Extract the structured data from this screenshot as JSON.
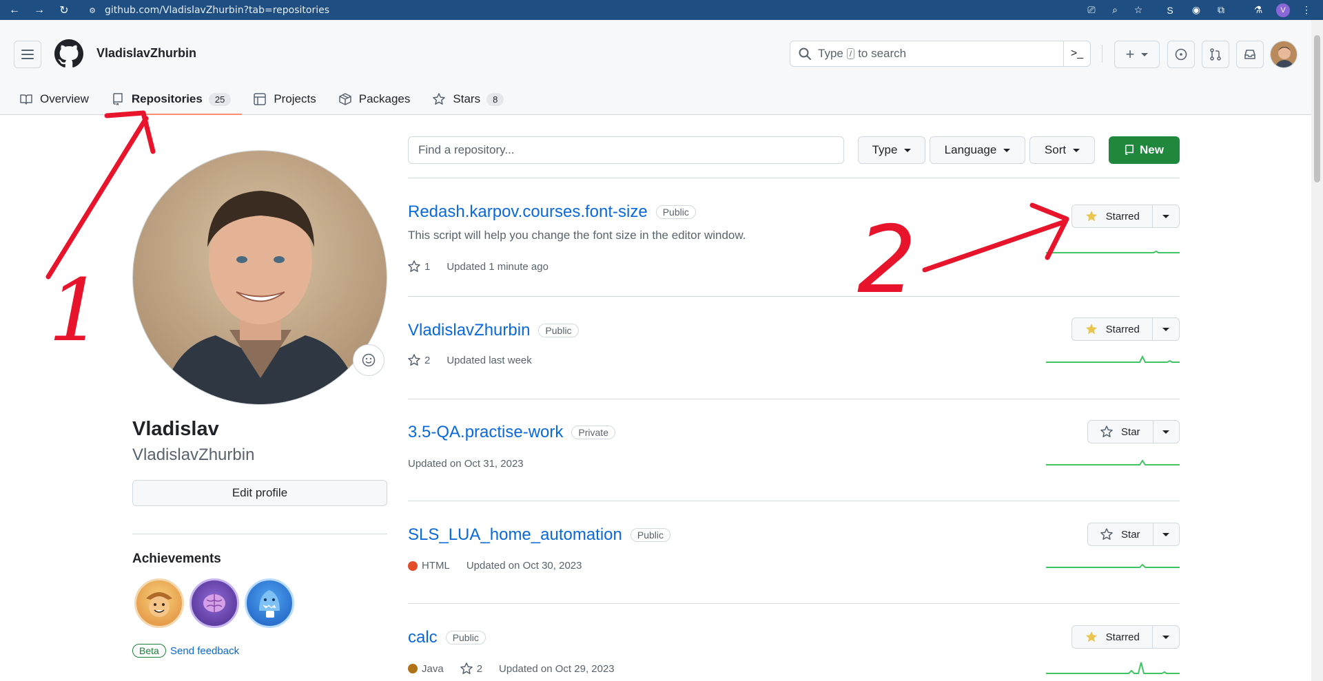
{
  "browser": {
    "url": "github.com/VladislavZhurbin?tab=repositories",
    "profile_initial": "V"
  },
  "header": {
    "username": "VladislavZhurbin",
    "search_placeholder_before": "Type",
    "search_key": "/",
    "search_placeholder_after": "to search"
  },
  "tabs": [
    {
      "label": "Overview",
      "icon": "book-icon"
    },
    {
      "label": "Repositories",
      "icon": "repo-icon",
      "count": "25",
      "active": true
    },
    {
      "label": "Projects",
      "icon": "table-icon"
    },
    {
      "label": "Packages",
      "icon": "package-icon"
    },
    {
      "label": "Stars",
      "icon": "star-icon",
      "count": "8"
    }
  ],
  "profile": {
    "name": "Vladislav",
    "login": "VladislavZhurbin",
    "edit_label": "Edit profile",
    "achievements_title": "Achievements",
    "beta_label": "Beta",
    "feedback_label": "Send feedback"
  },
  "filters": {
    "search_placeholder": "Find a repository...",
    "type_label": "Type",
    "language_label": "Language",
    "sort_label": "Sort",
    "new_label": "New"
  },
  "repos": [
    {
      "name": "Redash.karpov.courses.font-size",
      "visibility": "Public",
      "description": "This script will help you change the font size in the editor window.",
      "stars": "1",
      "updated": "Updated 1 minute ago",
      "star_label": "Starred",
      "starred": true
    },
    {
      "name": "VladislavZhurbin",
      "visibility": "Public",
      "stars": "2",
      "updated": "Updated last week",
      "star_label": "Starred",
      "starred": true
    },
    {
      "name": "3.5-QA.practise-work",
      "visibility": "Private",
      "updated": "Updated on Oct 31, 2023",
      "star_label": "Star",
      "starred": false
    },
    {
      "name": "SLS_LUA_home_automation",
      "visibility": "Public",
      "language": "HTML",
      "language_color": "#e34c26",
      "updated": "Updated on Oct 30, 2023",
      "star_label": "Star",
      "starred": false
    },
    {
      "name": "calc",
      "visibility": "Public",
      "language": "Java",
      "language_color": "#b07219",
      "stars": "2",
      "updated": "Updated on Oct 29, 2023",
      "star_label": "Starred",
      "starred": true
    }
  ],
  "annotations": [
    "1",
    "2"
  ],
  "colors": {
    "accent_green": "#1f883d",
    "link_blue": "#0969da",
    "annotation_red": "#e8142c",
    "star_yellow": "#eac54f"
  }
}
